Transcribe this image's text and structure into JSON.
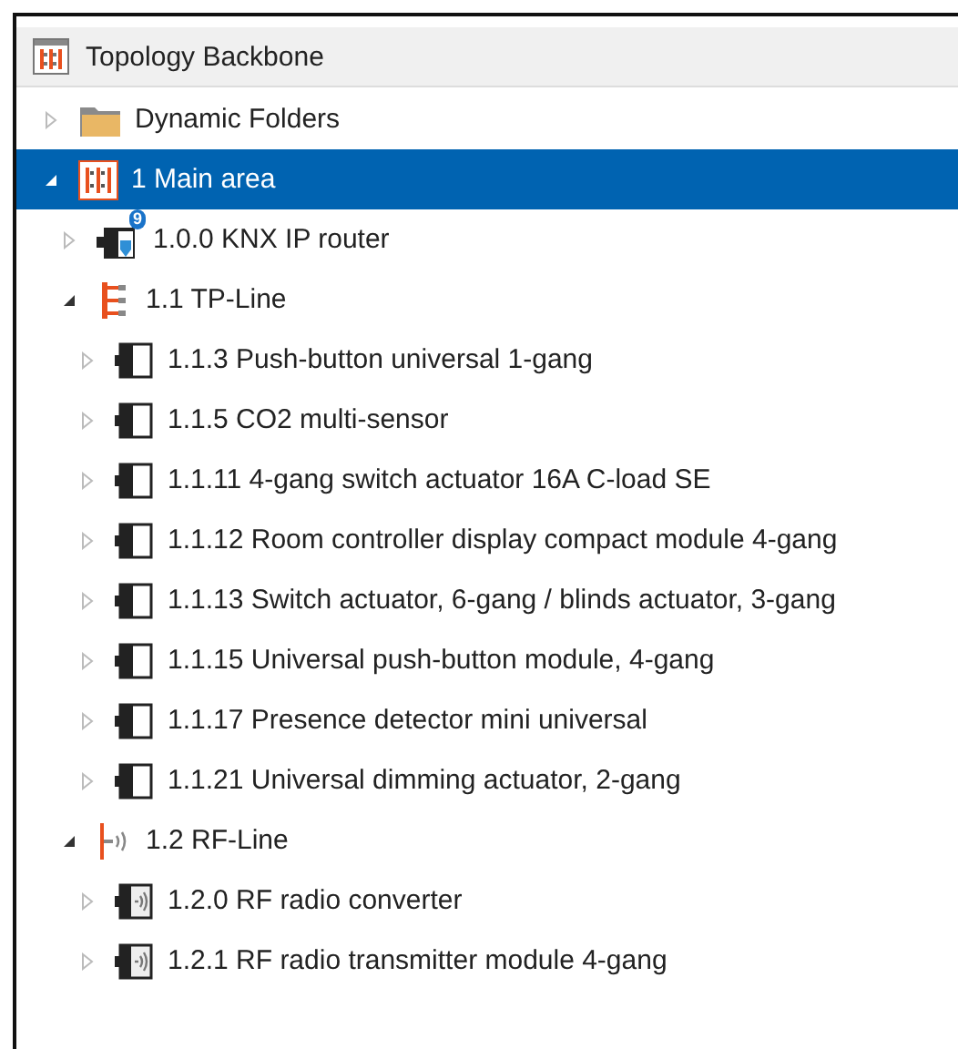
{
  "panel": {
    "title": "Topology Backbone"
  },
  "tree": [
    {
      "kind": "folder",
      "label": "Dynamic Folders",
      "expanded": false,
      "selected": false
    },
    {
      "kind": "area",
      "label": "1 Main area",
      "expanded": true,
      "selected": true,
      "children": [
        {
          "kind": "router",
          "label": "1.0.0 KNX IP router",
          "badge": "9",
          "expanded": false,
          "selected": false
        },
        {
          "kind": "tp-line",
          "label": "1.1 TP-Line",
          "expanded": true,
          "selected": false,
          "children": [
            {
              "kind": "device",
              "label": "1.1.3 Push-button universal 1-gang",
              "expanded": false,
              "selected": false
            },
            {
              "kind": "device",
              "label": "1.1.5 CO2 multi-sensor",
              "expanded": false,
              "selected": false
            },
            {
              "kind": "device",
              "label": "1.1.11 4-gang switch actuator 16A C-load SE",
              "expanded": false,
              "selected": false
            },
            {
              "kind": "device",
              "label": "1.1.12 Room controller display compact module 4-gang",
              "expanded": false,
              "selected": false
            },
            {
              "kind": "device",
              "label": "1.1.13 Switch actuator, 6-gang / blinds actuator, 3-gang",
              "expanded": false,
              "selected": false
            },
            {
              "kind": "device",
              "label": "1.1.15 Universal push-button module, 4-gang",
              "expanded": false,
              "selected": false
            },
            {
              "kind": "device",
              "label": "1.1.17 Presence detector mini universal",
              "expanded": false,
              "selected": false
            },
            {
              "kind": "device",
              "label": "1.1.21 Universal dimming actuator, 2-gang",
              "expanded": false,
              "selected": false
            }
          ]
        },
        {
          "kind": "rf-line",
          "label": "1.2 RF-Line",
          "expanded": true,
          "selected": false,
          "children": [
            {
              "kind": "rf-device",
              "label": "1.2.0 RF radio converter",
              "expanded": false,
              "selected": false
            },
            {
              "kind": "rf-device",
              "label": "1.2.1 RF radio transmitter module 4-gang",
              "expanded": false,
              "selected": false
            }
          ]
        }
      ]
    }
  ]
}
